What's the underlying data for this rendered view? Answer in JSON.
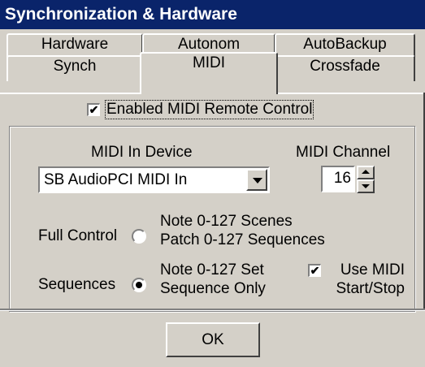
{
  "window": {
    "title": "Synchronization & Hardware"
  },
  "tabs": {
    "row1": [
      "Hardware",
      "Autonom",
      "AutoBackup"
    ],
    "row2": [
      "Synch",
      "MIDI",
      "Crossfade"
    ],
    "active": "MIDI"
  },
  "enable_remote": {
    "label": "Enabled MIDI Remote Control",
    "checked": true,
    "mark": "✔"
  },
  "midi_in": {
    "label": "MIDI In Device",
    "value": "SB AudioPCI MIDI In"
  },
  "midi_channel": {
    "label": "MIDI Channel",
    "value": "16"
  },
  "full_control": {
    "label": "Full Control",
    "selected": false,
    "line1": "Note 0-127 Scenes",
    "line2": "Patch 0-127 Sequences"
  },
  "sequences": {
    "label": "Sequences",
    "selected": true,
    "line1": "Note 0-127 Set",
    "line2": "Sequence Only"
  },
  "use_midi": {
    "line1": "Use MIDI",
    "line2": "Start/Stop",
    "checked": true,
    "mark": "✔"
  },
  "ok_button": {
    "label": "OK"
  },
  "colors": {
    "titlebar": "#0a246a",
    "face": "#d4d0c8"
  },
  "icons": [
    "checkbox-checked-icon",
    "dropdown-arrow-icon",
    "spin-up-icon",
    "spin-down-icon",
    "radio-icon"
  ]
}
